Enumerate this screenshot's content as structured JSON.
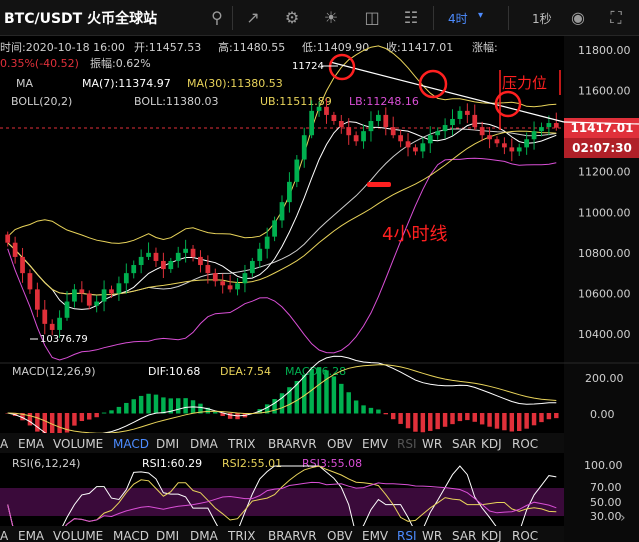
{
  "toolbar": {
    "title": "BTC/USDT 火币全球站",
    "interval": "4时",
    "speed": "1秒",
    "icons": [
      "search-icon",
      "indicator-icon",
      "settings-icon",
      "theme-icon",
      "layout-icon",
      "chart-type-icon",
      "camera-icon",
      "fullscreen-icon"
    ]
  },
  "ohlc": {
    "time": "时间:2020-10-18 16:00",
    "open": "开:11457.53",
    "high": "高:11480.55",
    "low": "低:11409.90",
    "close": "收:11417.01",
    "change_label": "涨幅:",
    "change": "-0.35%(-40.52)",
    "amplitude": "振幅:0.62%"
  },
  "legend": {
    "ma_label": "MA",
    "ma7": "MA(7):11374.97",
    "ma30": "MA(30):11380.53",
    "boll_label": "BOLL(20,2)",
    "boll": "BOLL:11380.03",
    "ub": "UB:11511.89",
    "lb": "LB:11248.16"
  },
  "annotations": {
    "resistance": "压力位",
    "timeframe": "4小时线",
    "high_marker": "11724",
    "low_marker": "10376.79"
  },
  "price_axis": {
    "ticks": [
      "11800.00",
      "11600.00",
      "11400.00",
      "11200.00",
      "11000.00",
      "10800.00",
      "10600.00",
      "10400.00"
    ],
    "current_price": "11417.01",
    "countdown": "02:07:30"
  },
  "macd": {
    "label": "MACD(12,26,9)",
    "dif": "DIF:10.68",
    "dea": "DEA:7.54",
    "macd": "MACD:6.28",
    "ticks": [
      "200.00",
      "0.00"
    ]
  },
  "tabs": [
    "A",
    "EMA",
    "VOLUME",
    "MACD",
    "DMI",
    "DMA",
    "TRIX",
    "BRAR",
    "VR",
    "OBV",
    "EMV",
    "RSI",
    "WR",
    "SAR",
    "KDJ",
    "ROC"
  ],
  "tabs2": [
    "A",
    "EMA",
    "VOLUME",
    "MACD",
    "DMI",
    "DMA",
    "TRIX",
    "BRAR",
    "VR",
    "OBV",
    "EMV",
    "RSI",
    "WR",
    "SAR",
    "KDJ",
    "ROC"
  ],
  "rsi": {
    "label": "RSI(6,12,24)",
    "rsi1": "RSI1:60.29",
    "rsi2": "RSI2:55.01",
    "rsi3": "RSI3:55.08",
    "ticks": [
      "100.00",
      "70.00",
      "50.00",
      "30.00"
    ]
  },
  "colors": {
    "up": "#00b050",
    "down": "#e0303a",
    "ma7": "#ffffff",
    "ma30": "#e8d35a",
    "lb": "#d94fd6",
    "accent": "#4d8cff",
    "annotation": "#ff2020"
  },
  "chart_data": {
    "type": "candlestick",
    "title": "BTC/USDT 火币全球站",
    "interval": "4时",
    "ylim": [
      10320,
      11860
    ],
    "y_ticks": [
      11800,
      11600,
      11400,
      11200,
      11000,
      10800,
      10600,
      10400
    ],
    "current_price": 11417.01,
    "high_marker": 11724,
    "low_marker": 10376.79,
    "closes": [
      10850,
      10780,
      10700,
      10620,
      10520,
      10450,
      10420,
      10480,
      10560,
      10620,
      10600,
      10540,
      10560,
      10620,
      10600,
      10650,
      10700,
      10740,
      10780,
      10800,
      10760,
      10720,
      10760,
      10800,
      10820,
      10780,
      10740,
      10700,
      10660,
      10640,
      10620,
      10650,
      10700,
      10760,
      10820,
      10880,
      10960,
      11050,
      11150,
      11260,
      11380,
      11500,
      11520,
      11480,
      11450,
      11420,
      11380,
      11350,
      11400,
      11450,
      11480,
      11420,
      11380,
      11350,
      11320,
      11300,
      11340,
      11380,
      11400,
      11430,
      11460,
      11500,
      11480,
      11420,
      11380,
      11360,
      11340,
      11320,
      11300,
      11320,
      11360,
      11400,
      11420,
      11440,
      11417
    ],
    "rsi_ylim": [
      20,
      100
    ],
    "macd_ylim": [
      -60,
      240
    ]
  }
}
